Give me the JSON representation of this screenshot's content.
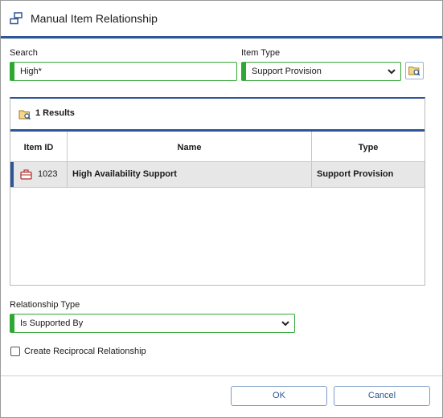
{
  "dialog": {
    "title": "Manual Item Relationship"
  },
  "search": {
    "label": "Search",
    "value": "High*"
  },
  "item_type": {
    "label": "Item Type",
    "selected": "Support Provision"
  },
  "results": {
    "summary": "1 Results",
    "columns": [
      "Item ID",
      "Name",
      "Type"
    ],
    "rows": [
      {
        "id": "1023",
        "name": "High Availability Support",
        "type": "Support Provision",
        "icon": "briefcase-icon"
      }
    ]
  },
  "relationship": {
    "label": "Relationship Type",
    "selected": "Is Supported By"
  },
  "reciprocal": {
    "label": "Create Reciprocal Relationship",
    "checked": false
  },
  "buttons": {
    "ok": "OK",
    "cancel": "Cancel"
  },
  "colors": {
    "accent": "#2e5596",
    "required": "#2ea832",
    "row_icon": "#b02a2a"
  }
}
